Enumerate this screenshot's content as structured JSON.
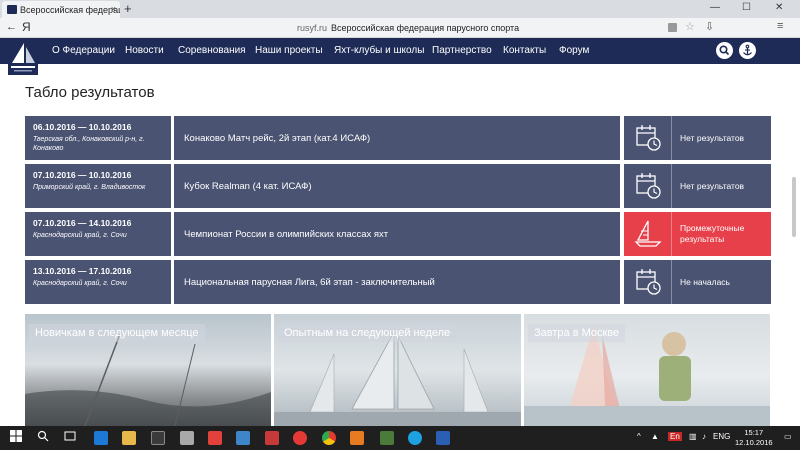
{
  "browser": {
    "tab_title": "Всероссийская федерац",
    "tab_close": "×",
    "new_tab": "+",
    "back": "←",
    "yandex_letter": "Я",
    "url_domain": "rusyf.ru",
    "url_title": "Всероссийская федерация парусного спорта",
    "window_controls": [
      "—",
      "☐",
      "✕"
    ]
  },
  "site": {
    "menu": [
      "О Федерации",
      "Новости",
      "Соревнования",
      "Наши проекты",
      "Яхт-клубы и школы",
      "Партнерство",
      "Контакты",
      "Форум"
    ],
    "search_icon": "search-icon",
    "anchor_icon": "anchor-icon",
    "colors": {
      "nav": "#1e2b57",
      "row": "#4a5372",
      "alert": "#e7404a"
    }
  },
  "results": {
    "title": "Табло результатов",
    "rows": [
      {
        "dates": "06.10.2016 — 10.10.2016",
        "place": "Тверская обл., Конаковский р-н, г. Конаково",
        "name": "Конаково Матч рейс, 2й этап (кат.4 ИСАФ)",
        "status": "Нет результатов",
        "icon": "calendar-clock-icon"
      },
      {
        "dates": "07.10.2016 — 10.10.2016",
        "place": "Приморский край, г. Владивосток",
        "name": "Кубок Realman (4 кат. ИСАФ)",
        "status": "Нет результатов",
        "icon": "calendar-clock-icon"
      },
      {
        "dates": "07.10.2016 — 14.10.2016",
        "place": "Краснодарский край, г. Сочи",
        "name": "Чемпионат России в олимпийских классах яхт",
        "status": "Промежуточные результаты",
        "icon": "sailboat-icon"
      },
      {
        "dates": "13.10.2016 — 17.10.2016",
        "place": "Краснодарский край, г. Сочи",
        "name": "Национальная парусная Лига, 6й этап - заключительный",
        "status": "Не началась",
        "icon": "calendar-clock-icon"
      }
    ]
  },
  "promos": [
    {
      "label": "Новичкам в следующем месяце"
    },
    {
      "label": "Опытным на следующей неделе"
    },
    {
      "label": "Завтра в Москве"
    }
  ],
  "taskbar": {
    "lang": "ENG",
    "time": "15:17",
    "date": "12.10.2016"
  }
}
